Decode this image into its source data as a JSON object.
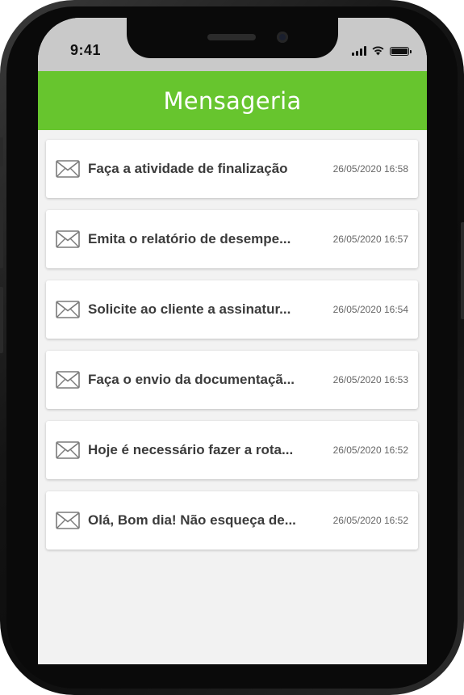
{
  "status_bar": {
    "time": "9:41",
    "icons": [
      "signal-icon",
      "wifi-icon",
      "battery-icon"
    ]
  },
  "header": {
    "title": "Mensageria",
    "color": "#67c52e"
  },
  "messages": [
    {
      "subject": "Faça a atividade de finalização",
      "date": "26/05/2020 16:58",
      "icon": "envelope-icon"
    },
    {
      "subject": "Emita o relatório de desempe...",
      "date": "26/05/2020 16:57",
      "icon": "envelope-icon"
    },
    {
      "subject": "Solicite ao cliente a assinatur...",
      "date": "26/05/2020 16:54",
      "icon": "envelope-icon"
    },
    {
      "subject": "Faça o envio da documentaçã...",
      "date": "26/05/2020 16:53",
      "icon": "envelope-icon"
    },
    {
      "subject": "Hoje é necessário fazer a rota...",
      "date": "26/05/2020 16:52",
      "icon": "envelope-icon"
    },
    {
      "subject": "Olá, Bom dia!  Não esqueça de...",
      "date": "26/05/2020 16:52",
      "icon": "envelope-icon"
    }
  ]
}
